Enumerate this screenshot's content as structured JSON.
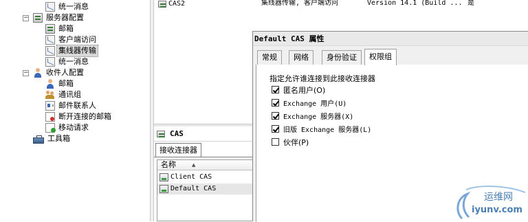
{
  "tree": {
    "items": [
      {
        "label": "统一消息",
        "icon": "mail-icon"
      },
      {
        "label": "服务器配置",
        "icon": "server-icon",
        "expander": "−"
      },
      {
        "label": "邮箱",
        "icon": "mailbox-icon"
      },
      {
        "label": "客户端访问",
        "icon": "client-access-icon"
      },
      {
        "label": "集线器传输",
        "icon": "hub-transport-icon",
        "selected": true
      },
      {
        "label": "统一消息",
        "icon": "unified-messaging-icon"
      },
      {
        "label": "收件人配置",
        "icon": "person-icon",
        "expander": "−"
      },
      {
        "label": "邮箱",
        "icon": "mailbox-icon"
      },
      {
        "label": "通讯组",
        "icon": "group-icon"
      },
      {
        "label": "邮件联系人",
        "icon": "contact-card-icon"
      },
      {
        "label": "断开连接的邮箱",
        "icon": "disconnected-mailbox-icon"
      },
      {
        "label": "移动请求",
        "icon": "move-request-icon"
      },
      {
        "label": "工具箱",
        "icon": "toolbox-icon"
      }
    ]
  },
  "server_list": {
    "row_name": "CAS2",
    "row_role": "集线器传输, 客户端访问",
    "row_version": "Version 14.1 (Build ...",
    "row_flag": "是"
  },
  "cas_panel": {
    "title": "CAS",
    "tab": "接收连接器",
    "column_header": "名称",
    "connectors": [
      {
        "name": "Client CAS",
        "selected": false
      },
      {
        "name": "Default CAS",
        "selected": true
      }
    ]
  },
  "dialog": {
    "title": "Default CAS 属性",
    "tabs": [
      "常规",
      "网络",
      "身份验证",
      "权限组"
    ],
    "active_tab": 3,
    "perm_label": "指定允许谁连接到此接收连接器",
    "permissions": [
      {
        "label": "匿名用户(O)",
        "checked": true
      },
      {
        "label": "Exchange 用户(U)",
        "checked": true
      },
      {
        "label": "Exchange 服务器(X)",
        "checked": true
      },
      {
        "label": "旧版 Exchange 服务器(L)",
        "checked": true
      },
      {
        "label": "伙伴(P)",
        "checked": false
      }
    ]
  },
  "watermark": {
    "line1": "运维网",
    "line2": "iyunv.com",
    "color": "#4a7fb5"
  }
}
